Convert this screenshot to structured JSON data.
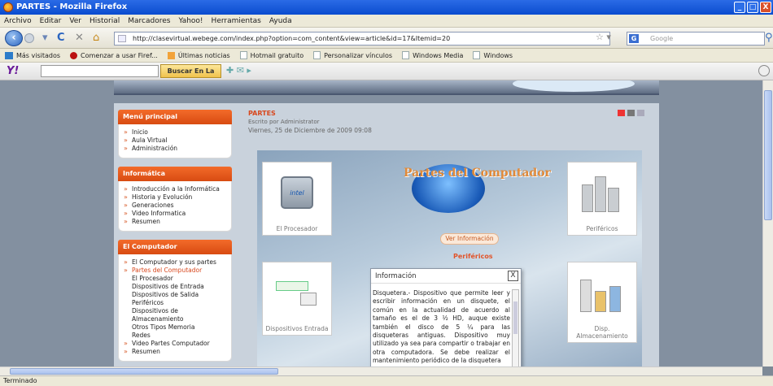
{
  "window": {
    "title": "PARTES - Mozilla Firefox",
    "controls": [
      "_",
      "□",
      "X"
    ]
  },
  "menubar": [
    "Archivo",
    "Editar",
    "Ver",
    "Historial",
    "Marcadores",
    "Yahoo!",
    "Herramientas",
    "Ayuda"
  ],
  "nav": {
    "url": "http://clasevirtual.webege.com/index.php?option=com_content&view=article&id=17&Itemid=20",
    "search_placeholder": "Google"
  },
  "bookmarks": [
    "Más visitados",
    "Comenzar a usar Firef...",
    "Últimas noticias",
    "Hotmail gratuito",
    "Personalizar vínculos",
    "Windows Media",
    "Windows"
  ],
  "yahoo_toolbar": {
    "logo": "Y!",
    "search_button": "Buscar En La Web"
  },
  "sidebar": {
    "menu_principal": {
      "title": "Menú principal",
      "items": [
        "Inicio",
        "Aula Virtual",
        "Administración"
      ]
    },
    "informatica": {
      "title": "Informática",
      "items": [
        "Introducción a la Informática",
        "Historia y Evolución",
        "Generaciones",
        "Video Informatica",
        "Resumen"
      ]
    },
    "computador": {
      "title": "El Computador",
      "items": [
        "El Computador y sus partes",
        "Partes del Computador"
      ],
      "subitems": [
        "El Procesador",
        "Dispositivos de Entrada",
        "Dispositivos de Salida",
        "Periféricos",
        "Dispositivos de Almacenamiento",
        "Otros Tipos Memoria",
        "Redes"
      ],
      "more_items": [
        "Video Partes Computador",
        "Resumen"
      ]
    }
  },
  "article": {
    "title": "PARTES",
    "author": "Escrito por Administrator",
    "date": "Viernes, 25 de Diciembre de 2009 09:08",
    "banner_title": "Partes del Computador",
    "chip_brand": "intel",
    "tiles": {
      "procesador": "El Procesador",
      "perifericos": "Periféricos",
      "entrada": "Dispositivos Entrada",
      "almacenamiento": "Disp. Almacenamiento"
    },
    "ver_informacion": "Ver Información",
    "section_label": "Periféricos"
  },
  "dialog": {
    "title": "Información",
    "close": "X",
    "text": "Disquetera.- Dispositivo que permite leer y escribir información en un disquete, el común en la actualidad de acuerdo al tamaño es el de 3 ½ HD, auque existe también el disco de 5 ¼ para las disqueteras antiguas. Dispositivo muy utilizado ya sea para compartir o trabajar en otra computadora. Se debe realizar el mantenimiento periódico de la disquetera"
  },
  "status": {
    "text": "Terminado"
  },
  "colors": {
    "accent_orange": "#e2542a",
    "titlebar_blue": "#0a4ccf"
  }
}
